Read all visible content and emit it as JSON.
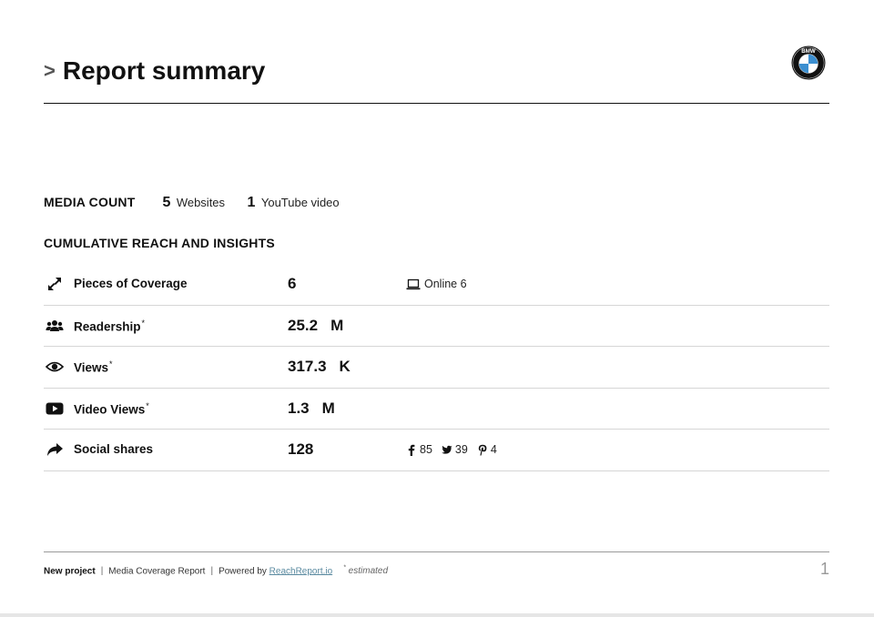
{
  "header": {
    "chevron": ">",
    "title": "Report summary",
    "logo_letters": "BMW"
  },
  "media_count": {
    "label": "MEDIA COUNT",
    "items": [
      {
        "num": "5",
        "unit": "Websites"
      },
      {
        "num": "1",
        "unit": "YouTube video"
      }
    ]
  },
  "section_title": "CUMULATIVE REACH AND INSIGHTS",
  "metrics": [
    {
      "label": "Pieces of Coverage",
      "estimated": "",
      "value": "6",
      "unit": "",
      "icon": "expand-icon",
      "extra": {
        "icon": "laptop-icon",
        "text": "Online 6"
      }
    },
    {
      "label": "Readership",
      "estimated": "*",
      "value": "25.2",
      "unit": "M",
      "icon": "users-icon"
    },
    {
      "label": "Views",
      "estimated": "*",
      "value": "317.3",
      "unit": "K",
      "icon": "eye-icon"
    },
    {
      "label": "Video Views",
      "estimated": "*",
      "value": "1.3",
      "unit": "M",
      "icon": "youtube-icon"
    },
    {
      "label": "Social shares",
      "estimated": "",
      "value": "128",
      "unit": "",
      "icon": "share-icon",
      "social": [
        {
          "icon": "facebook-icon",
          "count": "85"
        },
        {
          "icon": "twitter-icon",
          "count": "39"
        },
        {
          "icon": "pinterest-icon",
          "count": "4"
        }
      ]
    }
  ],
  "footer": {
    "project": "New project",
    "separator": "|",
    "report_type": "Media Coverage Report",
    "powered_by": "Powered by",
    "link_text": "ReachReport.io",
    "estimated_mark": "*",
    "estimated_text": "estimated",
    "page_number": "1"
  },
  "colors": {
    "text": "#111111",
    "divider": "#d6d6d6",
    "link": "#5a8aa0",
    "bmw_blue": "#3c8fd0"
  }
}
